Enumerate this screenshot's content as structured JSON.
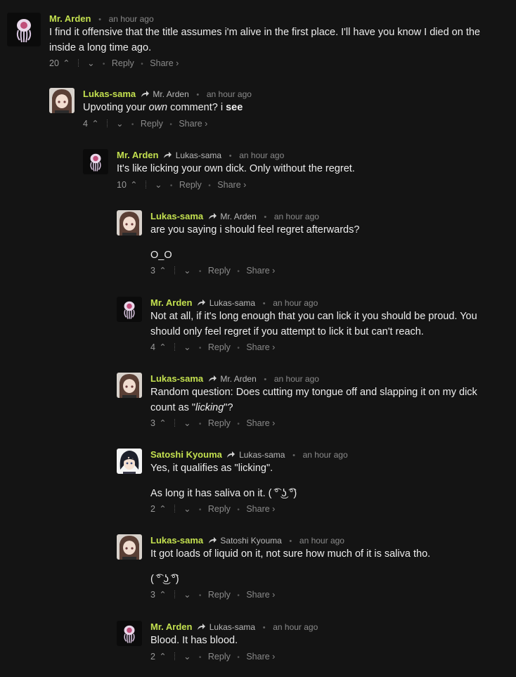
{
  "comments": [
    {
      "author": "Mr. Arden",
      "reply_to": "",
      "time": "an hour ago",
      "text": [
        "I find it offensive that the title assumes i'm alive in the first place. I'll have you know I died on the inside a long time ago."
      ],
      "votes": "20"
    },
    {
      "author": "Lukas-sama",
      "reply_to": "Mr. Arden",
      "time": "an hour ago",
      "text_parts": [
        "Upvoting your ",
        "own",
        " comment? i ",
        "see"
      ],
      "votes": "4"
    },
    {
      "author": "Mr. Arden",
      "reply_to": "Lukas-sama",
      "time": "an hour ago",
      "text": [
        "It's like licking your own dick. Only without the regret."
      ],
      "votes": "10"
    },
    {
      "author": "Lukas-sama",
      "reply_to": "Mr. Arden",
      "time": "an hour ago",
      "text": [
        "are you saying i should feel regret afterwards?",
        "O_O"
      ],
      "votes": "3"
    },
    {
      "author": "Mr. Arden",
      "reply_to": "Lukas-sama",
      "time": "an hour ago",
      "text": [
        "Not at all, if it's long enough that you can lick it you should be proud. You should only feel regret if you attempt to lick it but can't reach."
      ],
      "votes": "4"
    },
    {
      "author": "Lukas-sama",
      "reply_to": "Mr. Arden",
      "time": "an hour ago",
      "text_parts": [
        "Random question: Does cutting my tongue off and slapping it on my dick count as \"",
        "licking",
        "\"?"
      ],
      "votes": "3"
    },
    {
      "author": "Satoshi Kyouma",
      "reply_to": "Lukas-sama",
      "time": "an hour ago",
      "text": [
        "Yes, it qualifies as \"licking\".",
        "As long it has saliva on it. ( ͡° ͜ʖ ͡°)"
      ],
      "votes": "2"
    },
    {
      "author": "Lukas-sama",
      "reply_to": "Satoshi Kyouma",
      "time": "an hour ago",
      "text": [
        "It got loads of liquid on it, not sure how much of it is saliva tho.",
        "( ͡° ͜ʖ ͡°)"
      ],
      "votes": "3"
    },
    {
      "author": "Mr. Arden",
      "reply_to": "Lukas-sama",
      "time": "an hour ago",
      "text": [
        "Blood. It has blood."
      ],
      "votes": "2"
    }
  ],
  "labels": {
    "reply": "Reply",
    "share": "Share ›",
    "upvote": "⌃",
    "downvote": "⌄"
  },
  "icons": {
    "reply_arrow": "share-arrow-icon",
    "upvote": "chevron-up-icon",
    "downvote": "chevron-down-icon"
  },
  "colors": {
    "background": "#141414",
    "author": "#c3e04f",
    "text": "#ededed",
    "meta": "#8a8a8a"
  }
}
